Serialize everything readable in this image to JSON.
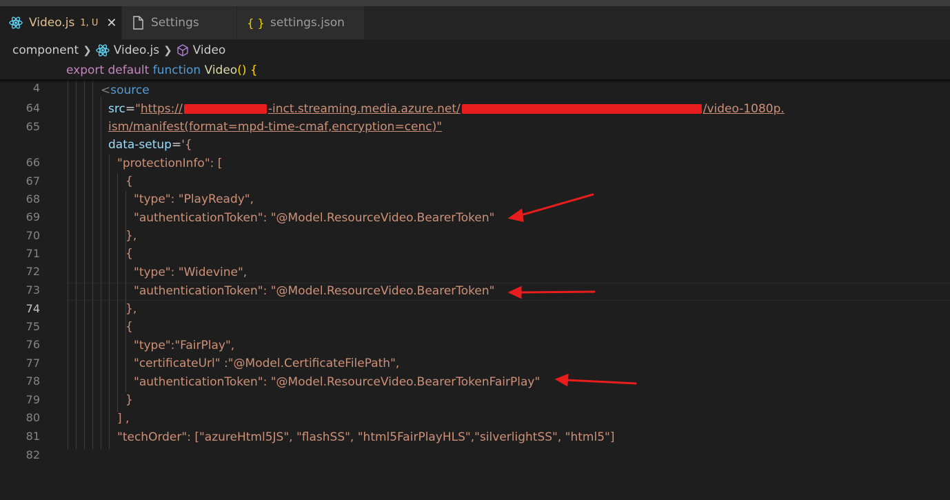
{
  "tabs": [
    {
      "label": "Video.js",
      "status": "1, U",
      "icon": "react-icon",
      "active": true
    },
    {
      "label": "Settings",
      "icon": "file-icon",
      "active": false
    },
    {
      "label": "settings.json",
      "icon": "json-braces-icon",
      "active": false
    }
  ],
  "breadcrumb": {
    "folder": "component",
    "file": "Video.js",
    "symbol": "Video"
  },
  "sticky": {
    "line_number": "4",
    "kw_export": "export",
    "kw_default": "default",
    "kw_function": "function",
    "fn_name": "Video",
    "parens": "()",
    "brace": "{"
  },
  "lines": {
    "l64": {
      "num": "64",
      "lt": "<",
      "tag": "source"
    },
    "l65": {
      "num": "65",
      "attr": "src",
      "eq": "=",
      "quote": "\"",
      "url_start": "https://",
      "url_mid": "-inct.streaming.media.azure.net/",
      "url_end": "/video-1080p."
    },
    "l65b": {
      "text": "ism/manifest(format=mpd-time-cmaf,encryption=cenc)\""
    },
    "l66": {
      "num": "66",
      "attr": "data-setup",
      "eq": "=",
      "text": "'{"
    },
    "l67": {
      "num": "67",
      "text": "\"protectionInfo\": ["
    },
    "l68": {
      "num": "68",
      "text": "{"
    },
    "l69": {
      "num": "69",
      "text": "\"type\": \"PlayReady\","
    },
    "l70": {
      "num": "70",
      "text": "\"authenticationToken\": \"@Model.ResourceVideo.BearerToken\""
    },
    "l71": {
      "num": "71",
      "text": "},"
    },
    "l72": {
      "num": "72",
      "text": "{"
    },
    "l73": {
      "num": "73",
      "text": "\"type\": \"Widevine\","
    },
    "l74": {
      "num": "74",
      "text": "\"authenticationToken\": \"@Model.ResourceVideo.BearerToken\""
    },
    "l75": {
      "num": "75",
      "text": "},"
    },
    "l76": {
      "num": "76",
      "text": "{"
    },
    "l77": {
      "num": "77",
      "text": "\"type\":\"FairPlay\","
    },
    "l78": {
      "num": "78",
      "text": "\"certificateUrl\" :\"@Model.CertificateFilePath\","
    },
    "l79": {
      "num": "79",
      "text": "\"authenticationToken\": \"@Model.ResourceVideo.BearerTokenFairPlay\""
    },
    "l80": {
      "num": "80",
      "text": "}"
    },
    "l81": {
      "num": "81",
      "text": "] ,"
    },
    "l82": {
      "num": "82",
      "text": "\"techOrder\": [\"azureHtml5JS\", \"flashSS\", \"html5FairPlayHLS\",\"silverlightSS\", \"html5\"]"
    }
  },
  "colors": {
    "annotation_arrow": "#e81d1d",
    "editor_bg": "#1e1e1e",
    "string": "#ce9178"
  }
}
